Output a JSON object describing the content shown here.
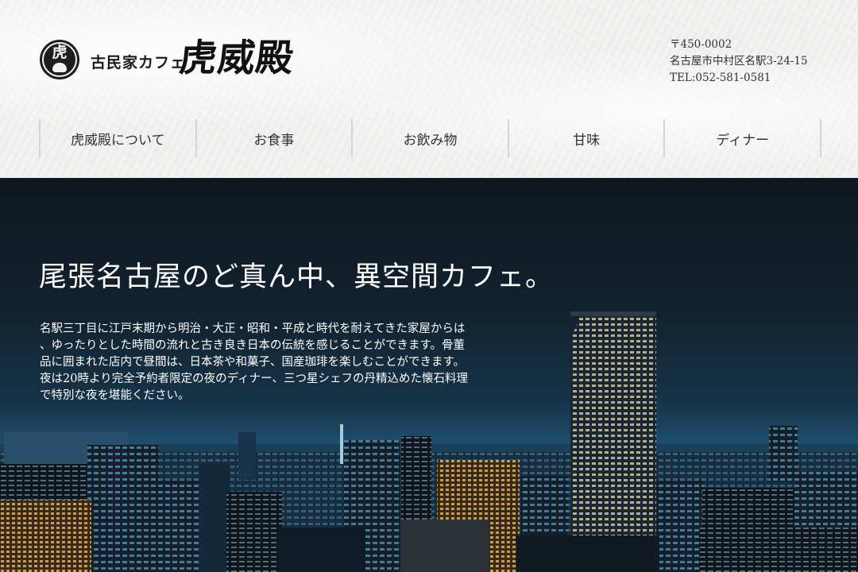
{
  "brand": {
    "mark_char": "虎",
    "subtitle": "古民家カフェ",
    "name": "虎威殿"
  },
  "address": {
    "postal": "〒450-0002",
    "street": "名古屋市中村区名駅3-24-15",
    "tel": "TEL:052-581-0581"
  },
  "nav": {
    "items": [
      {
        "label": "虎威殿について"
      },
      {
        "label": "お食事"
      },
      {
        "label": "お飲み物"
      },
      {
        "label": "甘味"
      },
      {
        "label": "ディナー"
      }
    ]
  },
  "hero": {
    "title": "尾張名古屋のど真ん中、異空間カフェ。",
    "lines": [
      "名駅三丁目に江戸末期から明治・大正・昭和・平成と時代を耐えてきた家屋からは",
      "、ゆったりとした時間の流れと古き良き日本の伝統を感じることができます。骨董",
      "品に囲まれた店内で昼間は、日本茶や和菓子、国産珈琲を楽しむことができます。",
      "夜は20時より完全予約者限定の夜のディナー、三つ星シェフの丹精込めた懐石料理",
      "で特別な夜を堪能ください。"
    ],
    "image_subject": "night-city-skyline"
  },
  "colors": {
    "header_bg": "#f2f2f1",
    "text_dark": "#1a1a1a",
    "hero_sky": "#122330",
    "hero_text": "#ffffff"
  }
}
